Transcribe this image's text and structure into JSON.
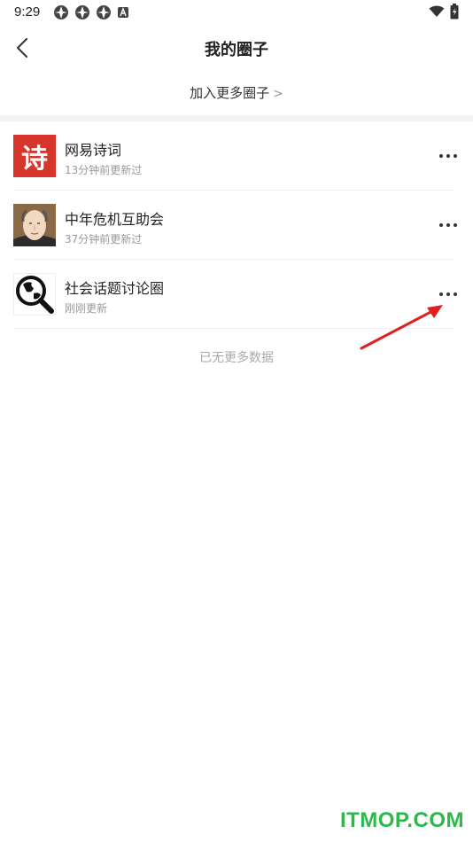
{
  "status_bar": {
    "time": "9:29"
  },
  "header": {
    "title": "我的圈子",
    "back_icon": "back-arrow-icon"
  },
  "join_more": {
    "label": "加入更多圈子",
    "chevron": ">"
  },
  "circles": [
    {
      "name": "网易诗词",
      "updated": "13分钟前更新过",
      "avatar_text": "诗"
    },
    {
      "name": "中年危机互助会",
      "updated": "37分钟前更新过"
    },
    {
      "name": "社会话题讨论圈",
      "updated": "刚刚更新"
    }
  ],
  "footer": {
    "no_more": "已无更多数据"
  },
  "watermark": "ITMOP.COM",
  "colors": {
    "poetry_red": "#d7372b",
    "annotation_red": "#e0201e",
    "watermark_green": "#2db84b"
  }
}
